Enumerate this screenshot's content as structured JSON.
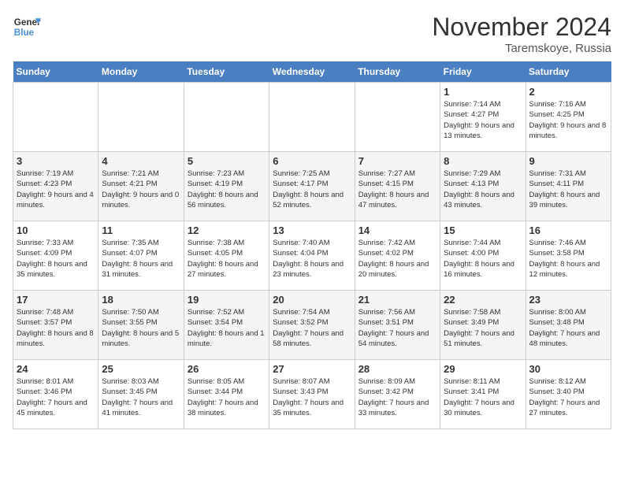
{
  "logo": {
    "text_general": "General",
    "text_blue": "Blue"
  },
  "title": "November 2024",
  "location": "Taremskoye, Russia",
  "weekdays": [
    "Sunday",
    "Monday",
    "Tuesday",
    "Wednesday",
    "Thursday",
    "Friday",
    "Saturday"
  ],
  "weeks": [
    [
      {
        "day": "",
        "info": ""
      },
      {
        "day": "",
        "info": ""
      },
      {
        "day": "",
        "info": ""
      },
      {
        "day": "",
        "info": ""
      },
      {
        "day": "",
        "info": ""
      },
      {
        "day": "1",
        "info": "Sunrise: 7:14 AM\nSunset: 4:27 PM\nDaylight: 9 hours and 13 minutes."
      },
      {
        "day": "2",
        "info": "Sunrise: 7:16 AM\nSunset: 4:25 PM\nDaylight: 9 hours and 8 minutes."
      }
    ],
    [
      {
        "day": "3",
        "info": "Sunrise: 7:19 AM\nSunset: 4:23 PM\nDaylight: 9 hours and 4 minutes."
      },
      {
        "day": "4",
        "info": "Sunrise: 7:21 AM\nSunset: 4:21 PM\nDaylight: 9 hours and 0 minutes."
      },
      {
        "day": "5",
        "info": "Sunrise: 7:23 AM\nSunset: 4:19 PM\nDaylight: 8 hours and 56 minutes."
      },
      {
        "day": "6",
        "info": "Sunrise: 7:25 AM\nSunset: 4:17 PM\nDaylight: 8 hours and 52 minutes."
      },
      {
        "day": "7",
        "info": "Sunrise: 7:27 AM\nSunset: 4:15 PM\nDaylight: 8 hours and 47 minutes."
      },
      {
        "day": "8",
        "info": "Sunrise: 7:29 AM\nSunset: 4:13 PM\nDaylight: 8 hours and 43 minutes."
      },
      {
        "day": "9",
        "info": "Sunrise: 7:31 AM\nSunset: 4:11 PM\nDaylight: 8 hours and 39 minutes."
      }
    ],
    [
      {
        "day": "10",
        "info": "Sunrise: 7:33 AM\nSunset: 4:09 PM\nDaylight: 8 hours and 35 minutes."
      },
      {
        "day": "11",
        "info": "Sunrise: 7:35 AM\nSunset: 4:07 PM\nDaylight: 8 hours and 31 minutes."
      },
      {
        "day": "12",
        "info": "Sunrise: 7:38 AM\nSunset: 4:05 PM\nDaylight: 8 hours and 27 minutes."
      },
      {
        "day": "13",
        "info": "Sunrise: 7:40 AM\nSunset: 4:04 PM\nDaylight: 8 hours and 23 minutes."
      },
      {
        "day": "14",
        "info": "Sunrise: 7:42 AM\nSunset: 4:02 PM\nDaylight: 8 hours and 20 minutes."
      },
      {
        "day": "15",
        "info": "Sunrise: 7:44 AM\nSunset: 4:00 PM\nDaylight: 8 hours and 16 minutes."
      },
      {
        "day": "16",
        "info": "Sunrise: 7:46 AM\nSunset: 3:58 PM\nDaylight: 8 hours and 12 minutes."
      }
    ],
    [
      {
        "day": "17",
        "info": "Sunrise: 7:48 AM\nSunset: 3:57 PM\nDaylight: 8 hours and 8 minutes."
      },
      {
        "day": "18",
        "info": "Sunrise: 7:50 AM\nSunset: 3:55 PM\nDaylight: 8 hours and 5 minutes."
      },
      {
        "day": "19",
        "info": "Sunrise: 7:52 AM\nSunset: 3:54 PM\nDaylight: 8 hours and 1 minute."
      },
      {
        "day": "20",
        "info": "Sunrise: 7:54 AM\nSunset: 3:52 PM\nDaylight: 7 hours and 58 minutes."
      },
      {
        "day": "21",
        "info": "Sunrise: 7:56 AM\nSunset: 3:51 PM\nDaylight: 7 hours and 54 minutes."
      },
      {
        "day": "22",
        "info": "Sunrise: 7:58 AM\nSunset: 3:49 PM\nDaylight: 7 hours and 51 minutes."
      },
      {
        "day": "23",
        "info": "Sunrise: 8:00 AM\nSunset: 3:48 PM\nDaylight: 7 hours and 48 minutes."
      }
    ],
    [
      {
        "day": "24",
        "info": "Sunrise: 8:01 AM\nSunset: 3:46 PM\nDaylight: 7 hours and 45 minutes."
      },
      {
        "day": "25",
        "info": "Sunrise: 8:03 AM\nSunset: 3:45 PM\nDaylight: 7 hours and 41 minutes."
      },
      {
        "day": "26",
        "info": "Sunrise: 8:05 AM\nSunset: 3:44 PM\nDaylight: 7 hours and 38 minutes."
      },
      {
        "day": "27",
        "info": "Sunrise: 8:07 AM\nSunset: 3:43 PM\nDaylight: 7 hours and 35 minutes."
      },
      {
        "day": "28",
        "info": "Sunrise: 8:09 AM\nSunset: 3:42 PM\nDaylight: 7 hours and 33 minutes."
      },
      {
        "day": "29",
        "info": "Sunrise: 8:11 AM\nSunset: 3:41 PM\nDaylight: 7 hours and 30 minutes."
      },
      {
        "day": "30",
        "info": "Sunrise: 8:12 AM\nSunset: 3:40 PM\nDaylight: 7 hours and 27 minutes."
      }
    ]
  ]
}
